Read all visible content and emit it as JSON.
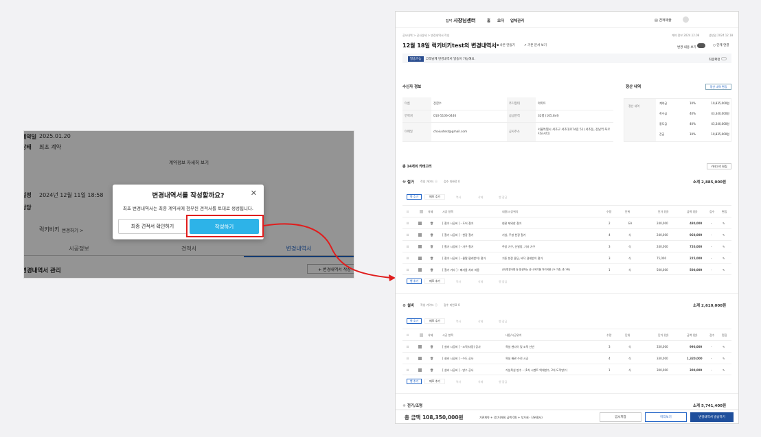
{
  "left": {
    "row1_label": "계약일",
    "row1_value": "2025.01.20",
    "row2_label": "상태",
    "row2_value": "최초 계약",
    "detail_link": "계약정보 자세히 보기",
    "row3_label": "일정",
    "row3_value": "2024년 12월 11일 18:58",
    "row4_label": "담당",
    "row5_name": "럭키비키",
    "row5_link": "변경하기 >",
    "tabs": [
      "시공정보",
      "견적서",
      "변경내역서"
    ],
    "section_title": "변경내역서 관리",
    "add_button": "+ 변경내역서 작성"
  },
  "modal": {
    "title": "변경내역서를 작성할까요?",
    "description": "최초 변경내역서는 최종 계약서에 첨부된 견적서를 토대로 생성됩니다.",
    "secondary": "최종 견적서 확인하기",
    "primary": "작성하기"
  },
  "right": {
    "logo_prefix": "집닥",
    "logo": "사장님센터",
    "nav": [
      "홈",
      "오더",
      "업체관리"
    ],
    "estimate_link": "견적제출",
    "breadcrumb": "공사내역 > 공사상세 > 변경내역서 작성",
    "meta_left": "계약 정보 2024.12.08",
    "meta_right": "생성일 2024.12.18",
    "title": "12월 18일 럭키비키test의 변경내역서",
    "action1": "사본 만들기",
    "action2": "기존 문서 보기",
    "toggle_label": "변경 내용 보기",
    "search_label": "단계 연결",
    "badge": "발송가능",
    "notice": "고객님께 변경내역서 발송이 가능해요.",
    "notice_right": "최종확정",
    "recipient_title": "수신자 정보",
    "recipient": [
      {
        "k1": "이름",
        "v1": "장한수",
        "k2": "주거형태",
        "v2": "아파트"
      },
      {
        "k1": "연락처",
        "v1": "010-5106-0446",
        "k2": "공급면적",
        "v2": "32평 (105.8㎡)"
      },
      {
        "k1": "이메일",
        "v1": "choiuxtest@gmail.com",
        "k2": "공사주소",
        "v2": "서울특별시 서초구 서초대로74길 51 (서초동, 강남역 푸르지오시티)"
      }
    ],
    "settle_title": "정산 내역",
    "settle_button": "정산 내역 편집",
    "settle_label": "정산 내역",
    "settle": [
      {
        "name": "계약금",
        "pct": "10%",
        "amt": "10,835,000원"
      },
      {
        "name": "착수금",
        "pct": "40%",
        "amt": "43,340,000원"
      },
      {
        "name": "중도금",
        "pct": "40%",
        "amt": "43,340,000원"
      },
      {
        "name": "잔금",
        "pct": "10%",
        "amt": "10,835,000원"
      }
    ],
    "category_count": "총 14개의 카테고리",
    "category_edit": "카테고리 편집",
    "section1": {
      "name": "철거",
      "guide": "작성 가이드 ⓘ",
      "extra": "검수 미완료 0",
      "subtotal": "소계 2,885,000원",
      "btns": [
        "행 추가",
        "메모 추가",
        "복사",
        "삭제",
        "행 잠금"
      ],
      "headers": [
        "삭제",
        "시공 항목",
        "내용/시공위치",
        "수량",
        "단위",
        "단가 (원)",
        "금액 (원)",
        "검수",
        "편집"
      ],
      "rows": [
        {
          "item": "[ 철거 시공비 ] - 도어 철거",
          "desc": "현관 제외한 철거",
          "qty": "2",
          "unit": "EA",
          "price": "240,000",
          "amt": "480,000",
          "chk": "-"
        },
        {
          "item": "[ 철거 시공비 ] - 천장 철거",
          "desc": "거실, 주방 천장 철거",
          "qty": "4",
          "unit": "식",
          "price": "240,000",
          "amt": "960,000",
          "chk": "-"
        },
        {
          "item": "[ 철거 시공비 ] - 가구 철거",
          "desc": "주방 가구, 신발장, 기타 가구",
          "qty": "3",
          "unit": "식",
          "price": "240,000",
          "amt": "720,000",
          "chk": "-"
        },
        {
          "item": "[ 철거 시공비 ] - 물탈(걸레받이) 철거",
          "desc": "기존 천장 몰딩, 바닥 걸레받이 철거",
          "qty": "3",
          "unit": "식",
          "price": "75,000",
          "amt": "225,000",
          "chk": "-"
        },
        {
          "item": "[ 철거 기타 ] - 폐기물 처리 비용",
          "desc": "(위)변경사항 등 발생하는 공사 폐기물 처리비용 (1t 기준, 총 1회)",
          "qty": "1",
          "unit": "식",
          "price": "500,000",
          "amt": "500,000",
          "chk": "-"
        }
      ]
    },
    "section2": {
      "name": "설비",
      "guide": "작성 가이드 ⓘ",
      "extra": "검수 미완료 0",
      "subtotal": "소계 2,610,000원",
      "btns": [
        "행 추가",
        "메모 추가",
        "복사",
        "삭제",
        "행 잠금"
      ],
      "headers": [
        "삭제",
        "시공 항목",
        "내용/시공위치",
        "수량",
        "단위",
        "단가 (원)",
        "금액 (원)",
        "검수",
        "편집"
      ],
      "rows": [
        {
          "item": "[ 설비 시공비 ] - 조적(미장) 공사",
          "desc": "욕실 벤다이 및 조적 선반",
          "qty": "3",
          "unit": "식",
          "price": "330,000",
          "amt": "990,000",
          "chk": "-"
        },
        {
          "item": "[ 설비 시공비 ] - 수도 공사",
          "desc": "욕실 배관 수전 시공",
          "qty": "4",
          "unit": "식",
          "price": "330,000",
          "amt": "1,320,000",
          "chk": "-"
        },
        {
          "item": "[ 설비 시공비 ] - 방수 공사",
          "desc": "거실욕실 방수 – (1차 시멘트 액체방수, 2차 도막방수)",
          "qty": "1",
          "unit": "식",
          "price": "300,000",
          "amt": "300,000",
          "chk": "-"
        }
      ]
    },
    "section3_name": "전기/조명",
    "section3_subtotal": "소계 5,741,400원",
    "total_label": "총 금액",
    "total_value": "108,350,000원",
    "total_desc": "기존계약 + (추가)재외 금액 0원 + 부가세 - 단위절사)",
    "footer_btns": [
      "임시저장",
      "미리보기",
      "변경내역서 발송하기"
    ]
  }
}
